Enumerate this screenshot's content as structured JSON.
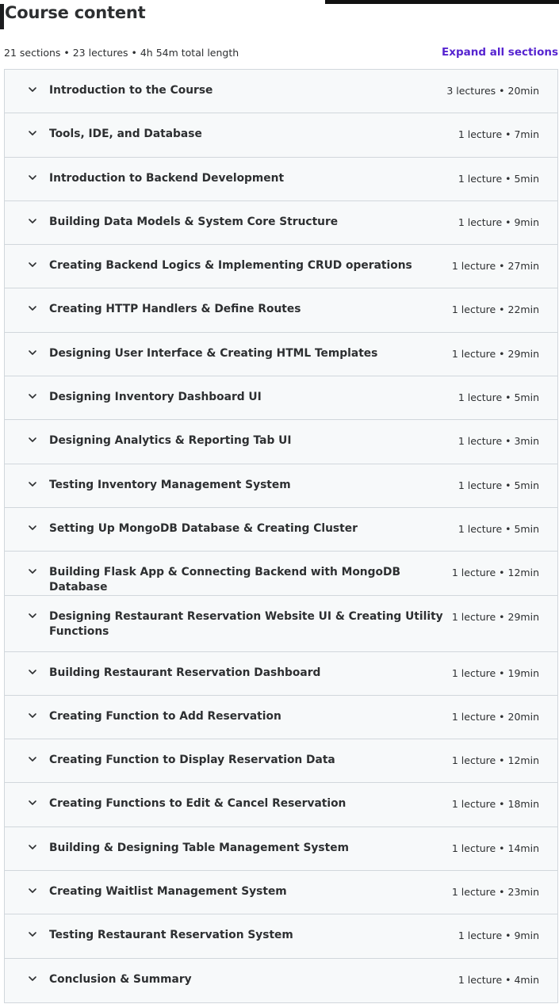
{
  "header": {
    "title": "Course content",
    "summary": "21 sections • 23 lectures • 4h 54m total length",
    "expand_label": "Expand all sections"
  },
  "colors": {
    "accent": "#5624d0",
    "section_bg": "#f7f9fa",
    "border": "#d1d7dc",
    "text": "#2d2f31"
  },
  "sections": [
    {
      "title": "Introduction to the Course",
      "meta": "3 lectures • 20min"
    },
    {
      "title": "Tools, IDE, and Database",
      "meta": "1 lecture • 7min"
    },
    {
      "title": "Introduction to Backend Development",
      "meta": "1 lecture • 5min"
    },
    {
      "title": "Building Data Models & System Core Structure",
      "meta": "1 lecture • 9min"
    },
    {
      "title": "Creating Backend Logics & Implementing CRUD operations",
      "meta": "1 lecture • 27min"
    },
    {
      "title": "Creating HTTP Handlers & Define Routes",
      "meta": "1 lecture • 22min"
    },
    {
      "title": "Designing User Interface & Creating HTML Templates",
      "meta": "1 lecture • 29min"
    },
    {
      "title": "Designing Inventory Dashboard UI",
      "meta": "1 lecture • 5min"
    },
    {
      "title": "Designing Analytics & Reporting Tab UI",
      "meta": "1 lecture • 3min"
    },
    {
      "title": "Testing Inventory Management System",
      "meta": "1 lecture • 5min"
    },
    {
      "title": "Setting Up MongoDB Database & Creating Cluster",
      "meta": "1 lecture • 5min"
    },
    {
      "title": "Building Flask App & Connecting Backend with MongoDB Database",
      "meta": "1 lecture • 12min"
    },
    {
      "title": "Designing Restaurant Reservation Website UI & Creating Utility Functions",
      "meta": "1 lecture • 29min"
    },
    {
      "title": "Building Restaurant Reservation Dashboard",
      "meta": "1 lecture • 19min"
    },
    {
      "title": "Creating Function to Add Reservation",
      "meta": "1 lecture • 20min"
    },
    {
      "title": "Creating Function to Display Reservation Data",
      "meta": "1 lecture • 12min"
    },
    {
      "title": "Creating Functions to Edit & Cancel Reservation",
      "meta": "1 lecture • 18min"
    },
    {
      "title": "Building & Designing Table Management System",
      "meta": "1 lecture • 14min"
    },
    {
      "title": "Creating Waitlist Management System",
      "meta": "1 lecture • 23min"
    },
    {
      "title": "Testing Restaurant Reservation System",
      "meta": "1 lecture • 9min"
    },
    {
      "title": "Conclusion & Summary",
      "meta": "1 lecture • 4min"
    }
  ]
}
